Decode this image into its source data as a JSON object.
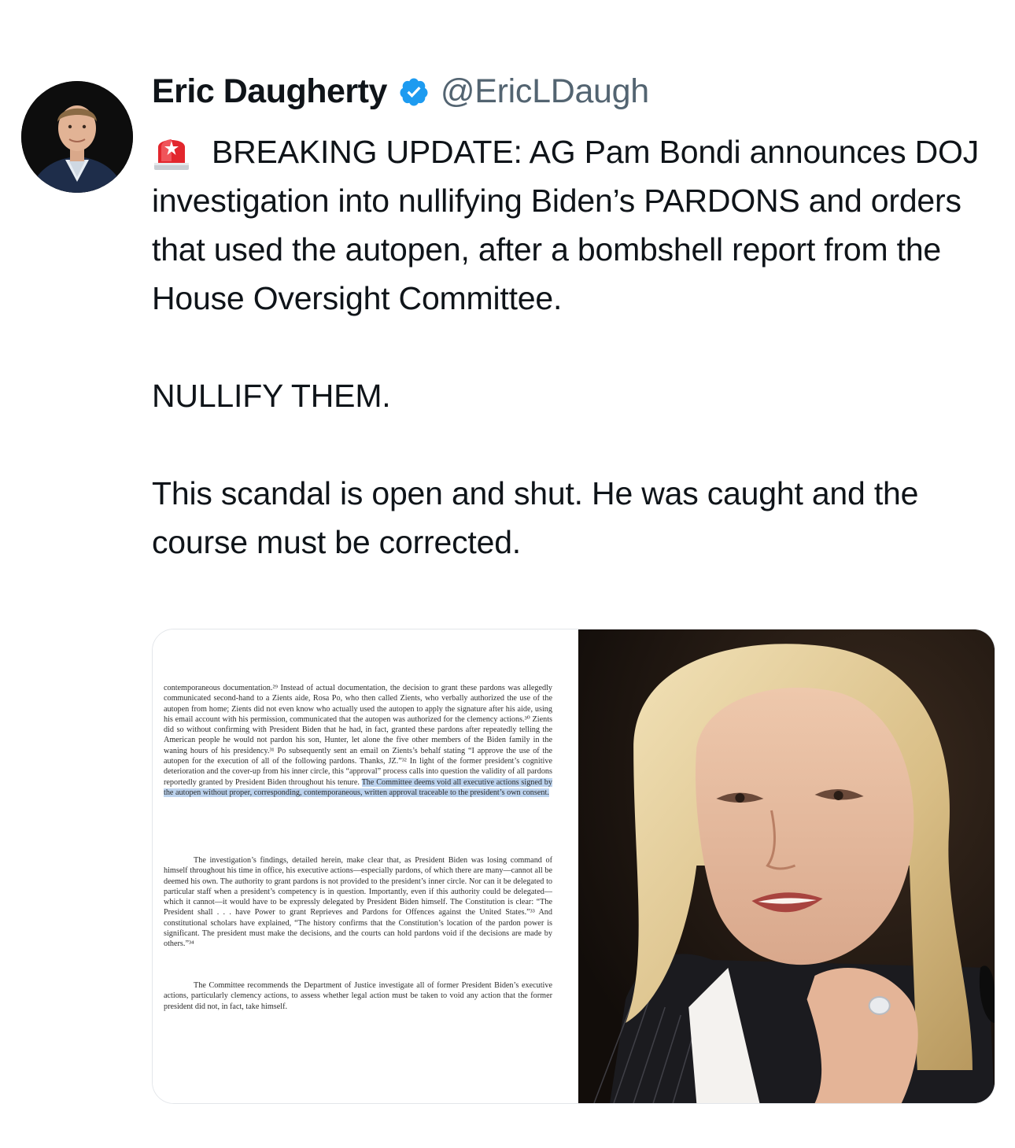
{
  "tweet": {
    "author_name": "Eric Daugherty",
    "author_handle": "@EricLDaugh",
    "verified_icon": "verified-badge-icon",
    "avatar": "avatar",
    "emoji": "police-siren-icon",
    "text_line1": "BREAKING UPDATE: AG Pam Bondi announces DOJ investigation into nullifying Biden’s PARDONS and orders that used the autopen, after a bombshell report from the House Oversight Committee.",
    "text_line2": "NULLIFY THEM.",
    "text_line3": "This scandal is open and shut. He was caught and the course must be corrected."
  },
  "media": {
    "document": {
      "para1_a": "contemporaneous documentation.²⁹ Instead of actual documentation, the decision to grant these pardons was allegedly communicated second-hand to a Zients aide, Rosa Po, who then called Zients, who verbally authorized the use of the autopen from home; Zients did not even know who actually used the autopen to apply the signature after his aide, using his email account with his permission, communicated that the autopen was authorized for the clemency actions.³⁰ Zients did so without confirming with President Biden that he had, in fact, granted these pardons after repeatedly telling the American people he would not pardon his son, Hunter, let alone the five other members of the Biden family in the waning hours of his presidency.³¹ Po subsequently sent an email on Zients’s behalf stating “I approve the use of the autopen for the execution of all of the following pardons. Thanks, JZ.”³² In light of the former president’s cognitive deterioration and the cover-up from his inner circle, this “approval” process calls into question the validity of all pardons reportedly granted by President Biden throughout his tenure.",
      "para1_highlight": "The Committee deems void all executive actions signed by the autopen without proper, corresponding, contemporaneous, written approval traceable to the president’s own consent.",
      "para2": "The investigation’s findings, detailed herein, make clear that, as President Biden was losing command of himself throughout his time in office, his executive actions—especially pardons, of which there are many—cannot all be deemed his own. The authority to grant pardons is not provided to the president’s inner circle. Nor can it be delegated to particular staff when a president’s competency is in question. Importantly, even if this authority could be delegated—which it cannot—it would have to be expressly delegated by President Biden himself. The Constitution is clear: “The President shall . . . have Power to grant Reprieves and Pardons for Offences against the United States.”³³ And constitutional scholars have explained, “The history confirms that the Constitution’s location of the pardon power is significant. The president must make the decisions, and the courts can hold pardons void if the decisions are made by others.”³⁴",
      "para3": "The Committee recommends the Department of Justice investigate all of former President Biden’s executive actions, particularly clemency actions, to assess whether legal action must be taken to void any action that the former president did not, in fact, take himself."
    },
    "photo": "pam-bondi-photo"
  }
}
